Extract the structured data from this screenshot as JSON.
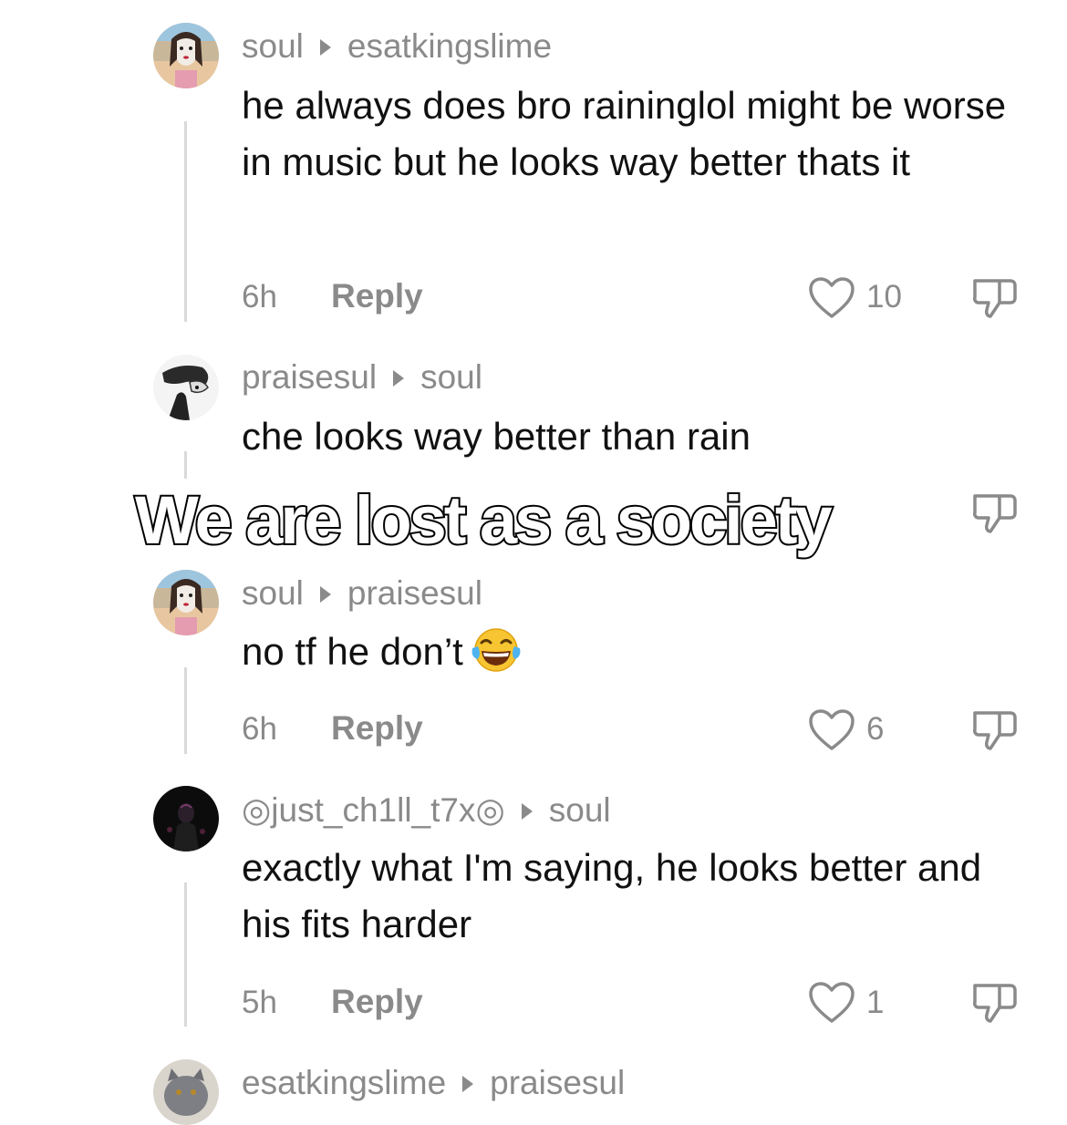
{
  "overlay": {
    "caption": "We are lost as a society"
  },
  "comments": [
    {
      "author": "soul",
      "reply_to": "esatkingslime",
      "text": "he always does bro raininglol might be worse in music but he looks way better thats it",
      "time": "6h",
      "reply_label": "Reply",
      "likes": "10",
      "avatar_icon": "avatar-soul"
    },
    {
      "author": "praisesul",
      "reply_to": "soul",
      "text": "che looks way better than rain",
      "avatar_icon": "avatar-praisesul"
    },
    {
      "author": "soul",
      "reply_to": "praisesul",
      "text": "no tf he don’t",
      "emoji": "face-with-tears-of-joy",
      "time": "6h",
      "reply_label": "Reply",
      "likes": "6",
      "avatar_icon": "avatar-soul"
    },
    {
      "author": "◎just_ch1ll_t7x◎",
      "reply_to": "soul",
      "text": "exactly what I'm saying, he looks better and his fits harder",
      "time": "5h",
      "reply_label": "Reply",
      "likes": "1",
      "avatar_icon": "avatar-dark-figure"
    },
    {
      "author": "esatkingslime",
      "reply_to": "praisesul",
      "avatar_icon": "avatar-cat"
    }
  ],
  "colors": {
    "secondary_text": "#8a8a8a",
    "primary_text": "#111111",
    "thread_line": "#d9d9d9"
  }
}
